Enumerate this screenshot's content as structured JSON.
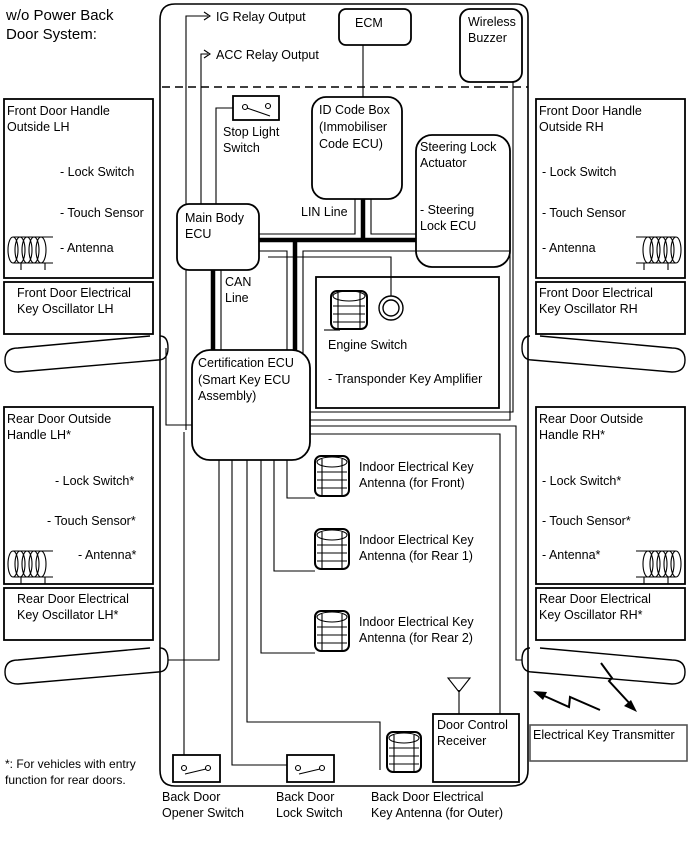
{
  "diagram": {
    "title": [
      "w/o Power Back",
      "Door System:"
    ],
    "footnote": [
      "*: For vehicles with entry",
      "function for rear doors."
    ],
    "outputs": {
      "ig_relay": "IG Relay Output",
      "acc_relay": "ACC Relay Output"
    },
    "ecm": "ECM",
    "wireless_buzzer": [
      "Wireless",
      "Buzzer"
    ],
    "stop_light_switch": [
      "Stop Light",
      "Switch"
    ],
    "id_code_box": [
      "ID Code Box",
      "(Immobiliser",
      "Code ECU)"
    ],
    "steering_lock": {
      "title": [
        "Steering Lock",
        "Actuator"
      ],
      "items": [
        "- Steering",
        "Lock ECU"
      ]
    },
    "main_body_ecu": [
      "Main Body",
      "ECU"
    ],
    "lin_line": "LIN Line",
    "can_line": [
      "CAN",
      "Line"
    ],
    "engine_switch": {
      "title": "Engine Switch",
      "item": "- Transponder Key Amplifier"
    },
    "certification_ecu": [
      "Certification ECU",
      "(Smart Key ECU",
      "Assembly)"
    ],
    "front_door_lh": {
      "title": [
        "Front Door Handle",
        "Outside LH"
      ],
      "items": [
        "- Lock Switch",
        "- Touch Sensor",
        "- Antenna"
      ],
      "oscillator": [
        "Front Door Electrical",
        "Key Oscillator LH"
      ]
    },
    "front_door_rh": {
      "title": [
        "Front Door Handle",
        "Outside RH"
      ],
      "items": [
        "- Lock Switch",
        "- Touch Sensor",
        "- Antenna"
      ],
      "oscillator": [
        "Front Door Electrical",
        "Key Oscillator RH"
      ]
    },
    "rear_door_lh": {
      "title": [
        "Rear Door Outside",
        "Handle LH*"
      ],
      "items": [
        "- Lock Switch*",
        "- Touch Sensor*",
        "- Antenna*"
      ],
      "oscillator": [
        "Rear Door Electrical",
        "Key Oscillator LH*"
      ]
    },
    "rear_door_rh": {
      "title": [
        "Rear Door Outside",
        "Handle RH*"
      ],
      "items": [
        "- Lock Switch*",
        "- Touch Sensor*",
        "- Antenna*"
      ],
      "oscillator": [
        "Rear Door Electrical",
        "Key Oscillator RH*"
      ]
    },
    "indoor_antennas": [
      [
        "Indoor Electrical Key",
        "Antenna (for Front)"
      ],
      [
        "Indoor Electrical Key",
        "Antenna (for Rear 1)"
      ],
      [
        "Indoor Electrical Key",
        "Antenna (for Rear 2)"
      ]
    ],
    "door_control_receiver": [
      "Door Control",
      "Receiver"
    ],
    "electrical_key_transmitter": "Electrical Key Transmitter",
    "back_door_opener_switch": [
      "Back Door",
      "Opener Switch"
    ],
    "back_door_lock_switch": [
      "Back Door",
      "Lock Switch"
    ],
    "back_door_antenna": [
      "Back Door Electrical",
      "Key Antenna (for Outer)"
    ]
  }
}
